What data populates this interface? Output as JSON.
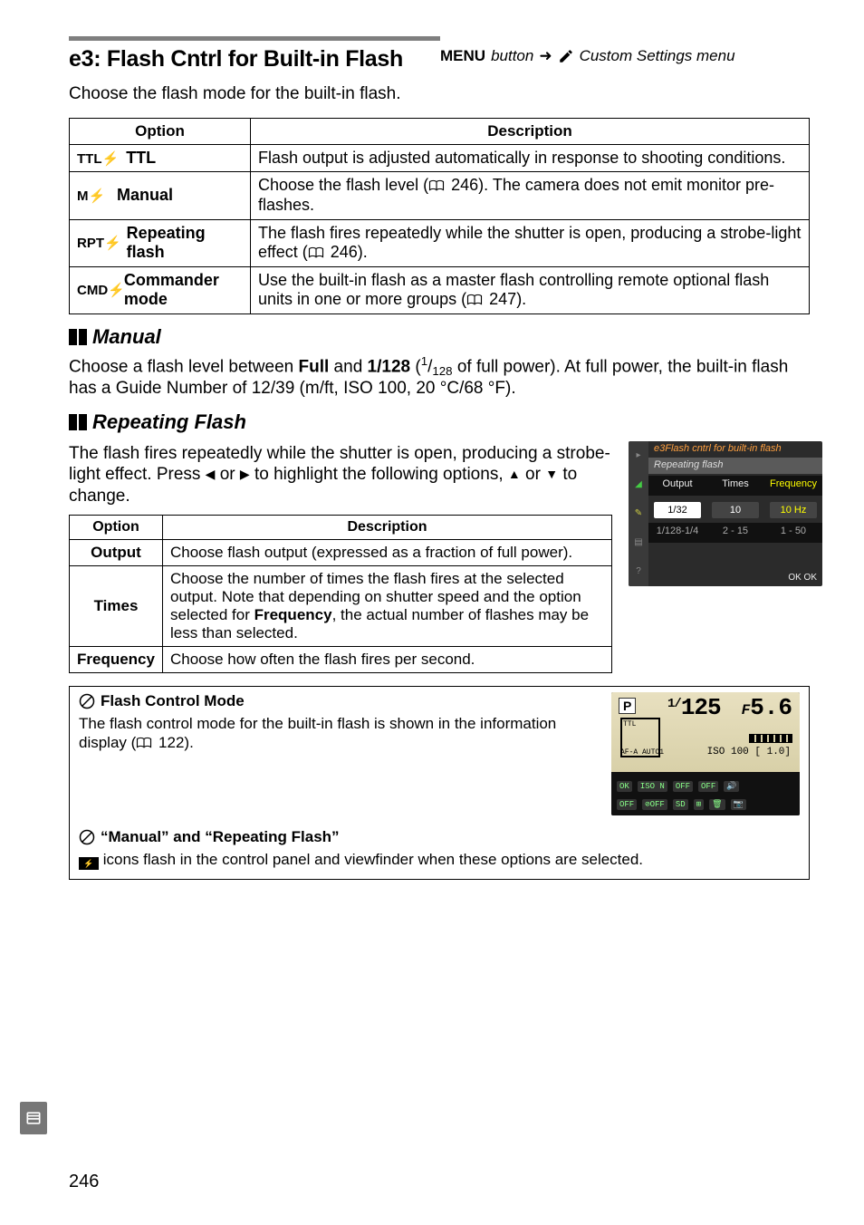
{
  "title": "e3: Flash Cntrl for Built-in Flash",
  "title_right": {
    "menu": "MENU",
    "button": "button",
    "cs": "Custom Settings menu"
  },
  "intro": "Choose the flash mode for the built-in flash.",
  "tbl1": {
    "h_option": "Option",
    "h_desc": "Description",
    "rows": [
      {
        "icon": "TTL",
        "bolt": "⚡",
        "label": "TTL",
        "desc": "Flash output is adjusted automatically in response to shooting conditions."
      },
      {
        "icon": "M",
        "bolt": "⚡",
        "label": "Manual",
        "desc_pre": "Choose the flash level (",
        "desc_ref": "246",
        "desc_post": "). The camera does not emit monitor pre-flashes."
      },
      {
        "icon": "RPT",
        "bolt": "⚡",
        "label": "Repeating flash",
        "desc_pre": "The flash fires repeatedly while the shutter is open, producing a strobe-light effect (",
        "desc_ref": "246",
        "desc_post": ")."
      },
      {
        "icon": "CMD",
        "bolt": "⚡",
        "label": "Commander mode",
        "desc_pre": "Use the built-in flash as a master flash controlling remote optional flash units in one or more groups (",
        "desc_ref": "247",
        "desc_post": ")."
      }
    ]
  },
  "manual": {
    "head": "Manual",
    "text_pre": "Choose a flash level between ",
    "full": "Full",
    "text_mid": " and ",
    "frac": "1/128",
    "sup": "1",
    "sub": "128",
    "text_post": " of full power).  At full power, the built-in flash has a Guide Number of 12/39 (m/ft, ISO 100, 20 °C/68 °F)."
  },
  "repeating": {
    "head": "Repeating Flash",
    "para": "The flash fires repeatedly while the shutter is open, producing a strobe-light effect.  Press ◀ or ▶ to highlight the following options, ▲ or ▼ to change."
  },
  "shot": {
    "line1": "e3Flash cntrl for built-in flash",
    "line2": "Repeating flash",
    "h1": "Output",
    "h2": "Times",
    "h3": "Frequency",
    "v1": "1/32",
    "v2": "10",
    "v3": "10 Hz",
    "r1": "1/128-1/4",
    "r2": "2 - 15",
    "r3": "1 - 50",
    "ok": "OK OK"
  },
  "tbl2": {
    "h_option": "Option",
    "h_desc": "Description",
    "rows": [
      {
        "opt": "Output",
        "desc": "Choose flash output (expressed as a fraction of full power)."
      },
      {
        "opt": "Times",
        "desc_pre": "Choose the number of times the flash fires at the selected output.  Note that depending on shutter speed and the option selected for ",
        "desc_b": "Frequency",
        "desc_post": ", the actual number of flashes may be less than selected."
      },
      {
        "opt": "Frequency",
        "desc": "Choose how often the flash fires per second."
      }
    ]
  },
  "note1": {
    "head": "Flash Control Mode",
    "text_pre": "The flash control mode for the built-in flash is shown in the information display (",
    "ref": "122",
    "text_post": ")."
  },
  "lcd": {
    "p": "P",
    "shutter_pre": "1/",
    "shutter": "125",
    "ap_f": "F",
    "ap": "5.6",
    "iso": "ISO 100   [  1.0]",
    "afrow": "AF-A  AUTO1"
  },
  "note2": {
    "head": "“Manual” and “Repeating Flash”",
    "text": " icons flash in the control panel and viewfinder when these options are selected."
  },
  "tokens": {
    "book": "📖"
  },
  "page": "246"
}
